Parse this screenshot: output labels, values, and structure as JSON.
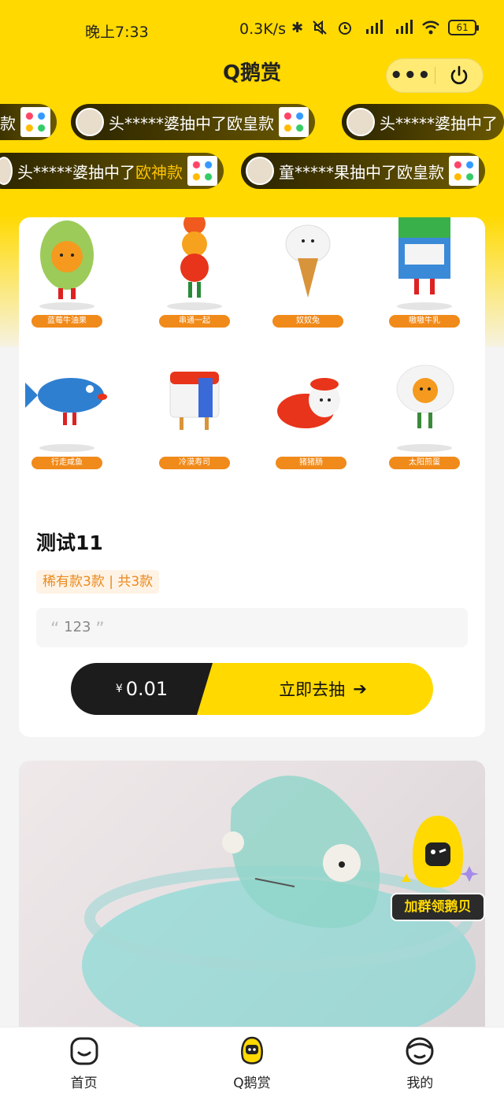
{
  "status_bar": {
    "time": "晚上7:33",
    "net_speed": "0.3K/s",
    "battery": "61",
    "icons": [
      "bluetooth-icon",
      "mute-icon",
      "alarm-icon",
      "signal-hd-icon",
      "signal-hd-icon",
      "wifi-icon",
      "battery-icon"
    ]
  },
  "nav": {
    "title": "Q鹅赏",
    "more_label": "•••"
  },
  "marquee": {
    "row1": [
      {
        "tail": "款"
      },
      {
        "user": "头*****婆",
        "text": "抽中了",
        "prize": "欧皇款"
      },
      {
        "user": "头*****婆",
        "text": "抽中了",
        "prize": ""
      }
    ],
    "row2": [
      {
        "user": "头*****婆",
        "text": "抽中了",
        "prize": "欧神款"
      },
      {
        "user": "童*****果",
        "text": "抽中了",
        "prize": "欧皇款"
      }
    ]
  },
  "series": {
    "figures": [
      {
        "name": "蓝莓牛油果"
      },
      {
        "name": "串通一起"
      },
      {
        "name": "奴奴兔"
      },
      {
        "name": "嗷嗷牛乳"
      },
      {
        "name": "行走咸鱼"
      },
      {
        "name": "冷漠寿司"
      },
      {
        "name": "猪猪肠"
      },
      {
        "name": "太阳煎蛋"
      }
    ],
    "title": "测试11",
    "rarity": "稀有款3款 | 共3款",
    "quote": "123",
    "price_symbol": "¥",
    "price": "0.01",
    "cta": "立即去抽",
    "cta_arrow": "➔"
  },
  "float_badge": {
    "label": "加群领鹅贝"
  },
  "tabbar": {
    "items": [
      {
        "label": "首页",
        "icon": "home-face-icon"
      },
      {
        "label": "Q鹅赏",
        "icon": "penguin-icon"
      },
      {
        "label": "我的",
        "icon": "profile-face-icon"
      }
    ]
  },
  "colors": {
    "brand_yellow": "#ffd900",
    "tag_orange": "#f08a1a",
    "dark": "#1c1c1c"
  }
}
